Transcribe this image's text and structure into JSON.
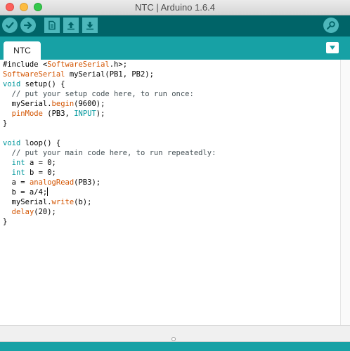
{
  "window": {
    "title": "NTC | Arduino 1.6.4"
  },
  "toolbar": {
    "buttons": [
      {
        "name": "verify",
        "icon": "checkmark-icon"
      },
      {
        "name": "upload",
        "icon": "arrow-right-icon"
      },
      {
        "name": "new",
        "icon": "document-icon"
      },
      {
        "name": "open",
        "icon": "arrow-up-icon"
      },
      {
        "name": "save",
        "icon": "arrow-down-icon"
      },
      {
        "name": "serial-monitor",
        "icon": "magnifier-icon"
      }
    ]
  },
  "tabs": [
    {
      "label": "NTC",
      "active": true
    }
  ],
  "tab_menu": {
    "icon": "triangle-down-icon"
  },
  "colors": {
    "toolbar_bg": "#006468",
    "tabstrip_bg": "#17a1a5",
    "button_bg": "#4db7bb",
    "keyword": "#00979c",
    "function": "#d35400"
  },
  "editor": {
    "lines": [
      [
        {
          "t": "#include <"
        },
        {
          "t": "SoftwareSerial",
          "c": "fn"
        },
        {
          "t": ".h>;"
        }
      ],
      [
        {
          "t": "SoftwareSerial",
          "c": "fn"
        },
        {
          "t": " mySerial(PB1, PB2);"
        }
      ],
      [
        {
          "t": "void",
          "c": "kw"
        },
        {
          "t": " setup() {"
        }
      ],
      [
        {
          "t": "  // put your setup code here, to run once:",
          "c": "cm"
        }
      ],
      [
        {
          "t": "  mySerial."
        },
        {
          "t": "begin",
          "c": "fn"
        },
        {
          "t": "(9600);"
        }
      ],
      [
        {
          "t": "  "
        },
        {
          "t": "pinMode",
          "c": "fn"
        },
        {
          "t": " (PB3, "
        },
        {
          "t": "INPUT",
          "c": "kw"
        },
        {
          "t": ");"
        }
      ],
      [
        {
          "t": "}"
        }
      ],
      [
        {
          "t": ""
        }
      ],
      [
        {
          "t": "void",
          "c": "kw"
        },
        {
          "t": " loop() {"
        }
      ],
      [
        {
          "t": "  // put your main code here, to run repeatedly:",
          "c": "cm"
        }
      ],
      [
        {
          "t": "  "
        },
        {
          "t": "int",
          "c": "kw"
        },
        {
          "t": " a = 0;"
        }
      ],
      [
        {
          "t": "  "
        },
        {
          "t": "int",
          "c": "kw"
        },
        {
          "t": " b = 0;"
        }
      ],
      [
        {
          "t": "  a = "
        },
        {
          "t": "analogRead",
          "c": "fn"
        },
        {
          "t": "(PB3);"
        }
      ],
      [
        {
          "t": "  b = a/4;"
        },
        {
          "t": "",
          "c": "caret"
        }
      ],
      [
        {
          "t": "  mySerial."
        },
        {
          "t": "write",
          "c": "fn"
        },
        {
          "t": "(b);"
        }
      ],
      [
        {
          "t": "  "
        },
        {
          "t": "delay",
          "c": "fn"
        },
        {
          "t": "(20);"
        }
      ],
      [
        {
          "t": "}"
        }
      ]
    ]
  }
}
